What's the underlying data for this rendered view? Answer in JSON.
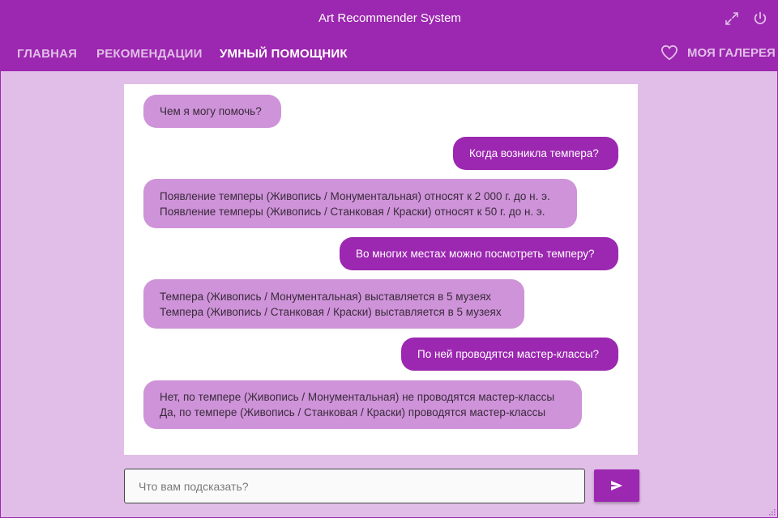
{
  "window": {
    "title": "Art Recommender System"
  },
  "nav": {
    "tabs": [
      {
        "label": "ГЛАВНАЯ",
        "active": false
      },
      {
        "label": "РЕКОМЕНДАЦИИ",
        "active": false
      },
      {
        "label": "УМНЫЙ ПОМОЩНИК",
        "active": true
      }
    ],
    "gallery_label": "МОЯ ГАЛЕРЕЯ"
  },
  "chat": {
    "messages": [
      {
        "role": "bot",
        "lines": [
          "Чем я могу помочь?"
        ]
      },
      {
        "role": "user",
        "lines": [
          "Когда возникла темпера?"
        ]
      },
      {
        "role": "bot",
        "lines": [
          "Появление темперы (Живопись / Монументальная) относят к 2 000 г. до н. э.",
          "Появление темперы (Живопись / Станковая / Краски) относят к 50 г. до н. э."
        ]
      },
      {
        "role": "user",
        "lines": [
          "Во многих местах можно посмотреть темперу?"
        ]
      },
      {
        "role": "bot",
        "lines": [
          "Темпера (Живопись / Монументальная) выставляется в 5 музеях",
          "Темпера (Живопись / Станковая / Краски) выставляется в 5 музеях"
        ]
      },
      {
        "role": "user",
        "lines": [
          "По ней проводятся мастер-классы?"
        ]
      },
      {
        "role": "bot",
        "lines": [
          "Нет, по темпере (Живопись / Монументальная) не проводятся мастер-классы",
          "Да, по темпере (Живопись / Станковая / Краски) проводятся мастер-классы"
        ]
      }
    ]
  },
  "composer": {
    "value": "",
    "placeholder": "Что вам подсказать?"
  },
  "icons": {
    "expand": "expand-icon",
    "power": "power-icon",
    "heart": "heart-outline-icon",
    "send": "send-icon"
  },
  "colors": {
    "primary": "#9c27b0",
    "bot_bubble": "#ce93d8",
    "background": "#e1bee7",
    "inactive_nav": "#e1bee7"
  }
}
